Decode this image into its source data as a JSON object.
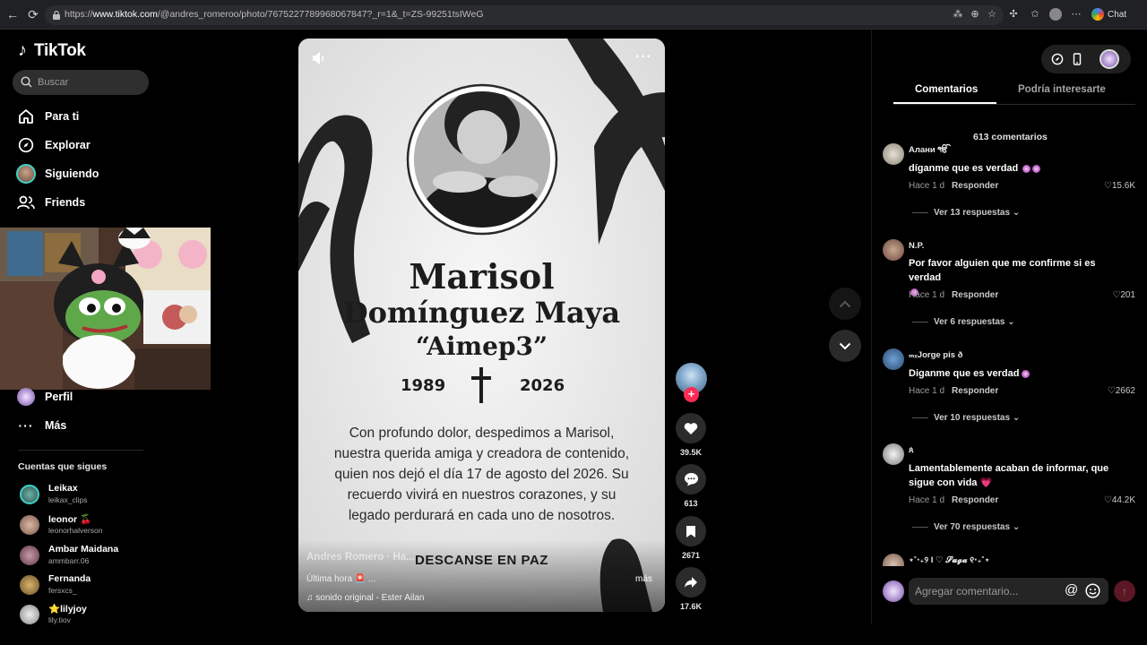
{
  "browser": {
    "url_prefix": "https://",
    "url_host": "www.tiktok.com",
    "url_path": "/@andres_romeroo/photo/7675227789968067847?_r=1&_t=ZS-99251tsIWeG",
    "chat_label": "Chat"
  },
  "sidebar": {
    "logo": "TikTok",
    "search_placeholder": "Buscar",
    "nav": [
      {
        "label": "Para ti",
        "icon": "home-icon"
      },
      {
        "label": "Explorar",
        "icon": "compass-icon"
      },
      {
        "label": "Siguiendo",
        "icon": "following-avatar-icon"
      },
      {
        "label": "Friends",
        "icon": "friends-icon"
      },
      {
        "label": "Perfil",
        "icon": "profile-avatar-icon"
      },
      {
        "label": "Más",
        "icon": "more-dots-icon"
      }
    ],
    "following_title": "Cuentas que sigues",
    "following": [
      {
        "name": "Leikax",
        "handle": "leikax_clips"
      },
      {
        "name": "leonor 🍒",
        "handle": "leonorhalverson"
      },
      {
        "name": "Ambar Maidana",
        "handle": "ammbarr.06"
      },
      {
        "name": "Fernanda",
        "handle": "fersxcs_"
      },
      {
        "name": "⭐lilyjoy",
        "handle": "lily.tiov"
      }
    ]
  },
  "post": {
    "name_line1": "Marisol",
    "name_line2": "Domínguez Maya",
    "nickname": "“Aimep3”",
    "year_birth": "1989",
    "year_death": "2026",
    "message": [
      "Con profundo dolor, despedimos a Marisol,",
      "nuestra querida amiga y creadora de contenido,",
      "quien nos dejó el día 17 de agosto del 2026. Su",
      "recuerdo vivirá en nuestros corazones, y su",
      "legado perdurará en cada uno de nosotros."
    ],
    "footer": "DESCANSE EN PAZ",
    "author": "Andres Romero · Ha...",
    "caption": "Última hora 🚨 ...",
    "more": "más",
    "sound": "sonido original - Ester Ailan"
  },
  "actions": {
    "likes": "39.5K",
    "comments": "613",
    "saves": "2671",
    "shares": "17.6K"
  },
  "panel": {
    "tab_comments": "Comentarios",
    "tab_interest": "Podría interesarte",
    "comment_count": "613 comentarios",
    "comments": [
      {
        "user": "Алани ੴ",
        "text": "díganme que es verdad",
        "time": "Hace 1 d",
        "reply": "Responder",
        "likes": "15.6K",
        "replies": "Ver 13 respuestas"
      },
      {
        "user": "N.P.",
        "text": "Por favor alguien que me confirme si es verdad",
        "time": "Hace 1 d",
        "reply": "Responder",
        "likes": "201",
        "replies": "Ver 6 respuestas"
      },
      {
        "user": "ₘₓJorge pis ð",
        "text": "Diganme que es verdad",
        "time": "Hace 1 d",
        "reply": "Responder",
        "likes": "2662",
        "replies": "Ver 10 respuestas"
      },
      {
        "user": "ጰ",
        "text": "Lamentablemente acaban de informar, que sigue con vida 💗",
        "time": "Hace 1 d",
        "reply": "Responder",
        "likes": "44.2K",
        "replies": "Ver 70 respuestas"
      },
      {
        "user": "⋆˚‧₊୨ I ♡ 𝓢𝓾𝓰𝓪 ୧‧₊˚⋆",
        "text": "",
        "time": "",
        "reply": "",
        "likes": "",
        "replies": ""
      }
    ],
    "add_placeholder": "Agregar comentario...",
    "at_symbol": "@"
  },
  "colors": {
    "accent": "#fe2c55",
    "panel_bg": "#000000",
    "memorial_bg": "#ececec"
  }
}
